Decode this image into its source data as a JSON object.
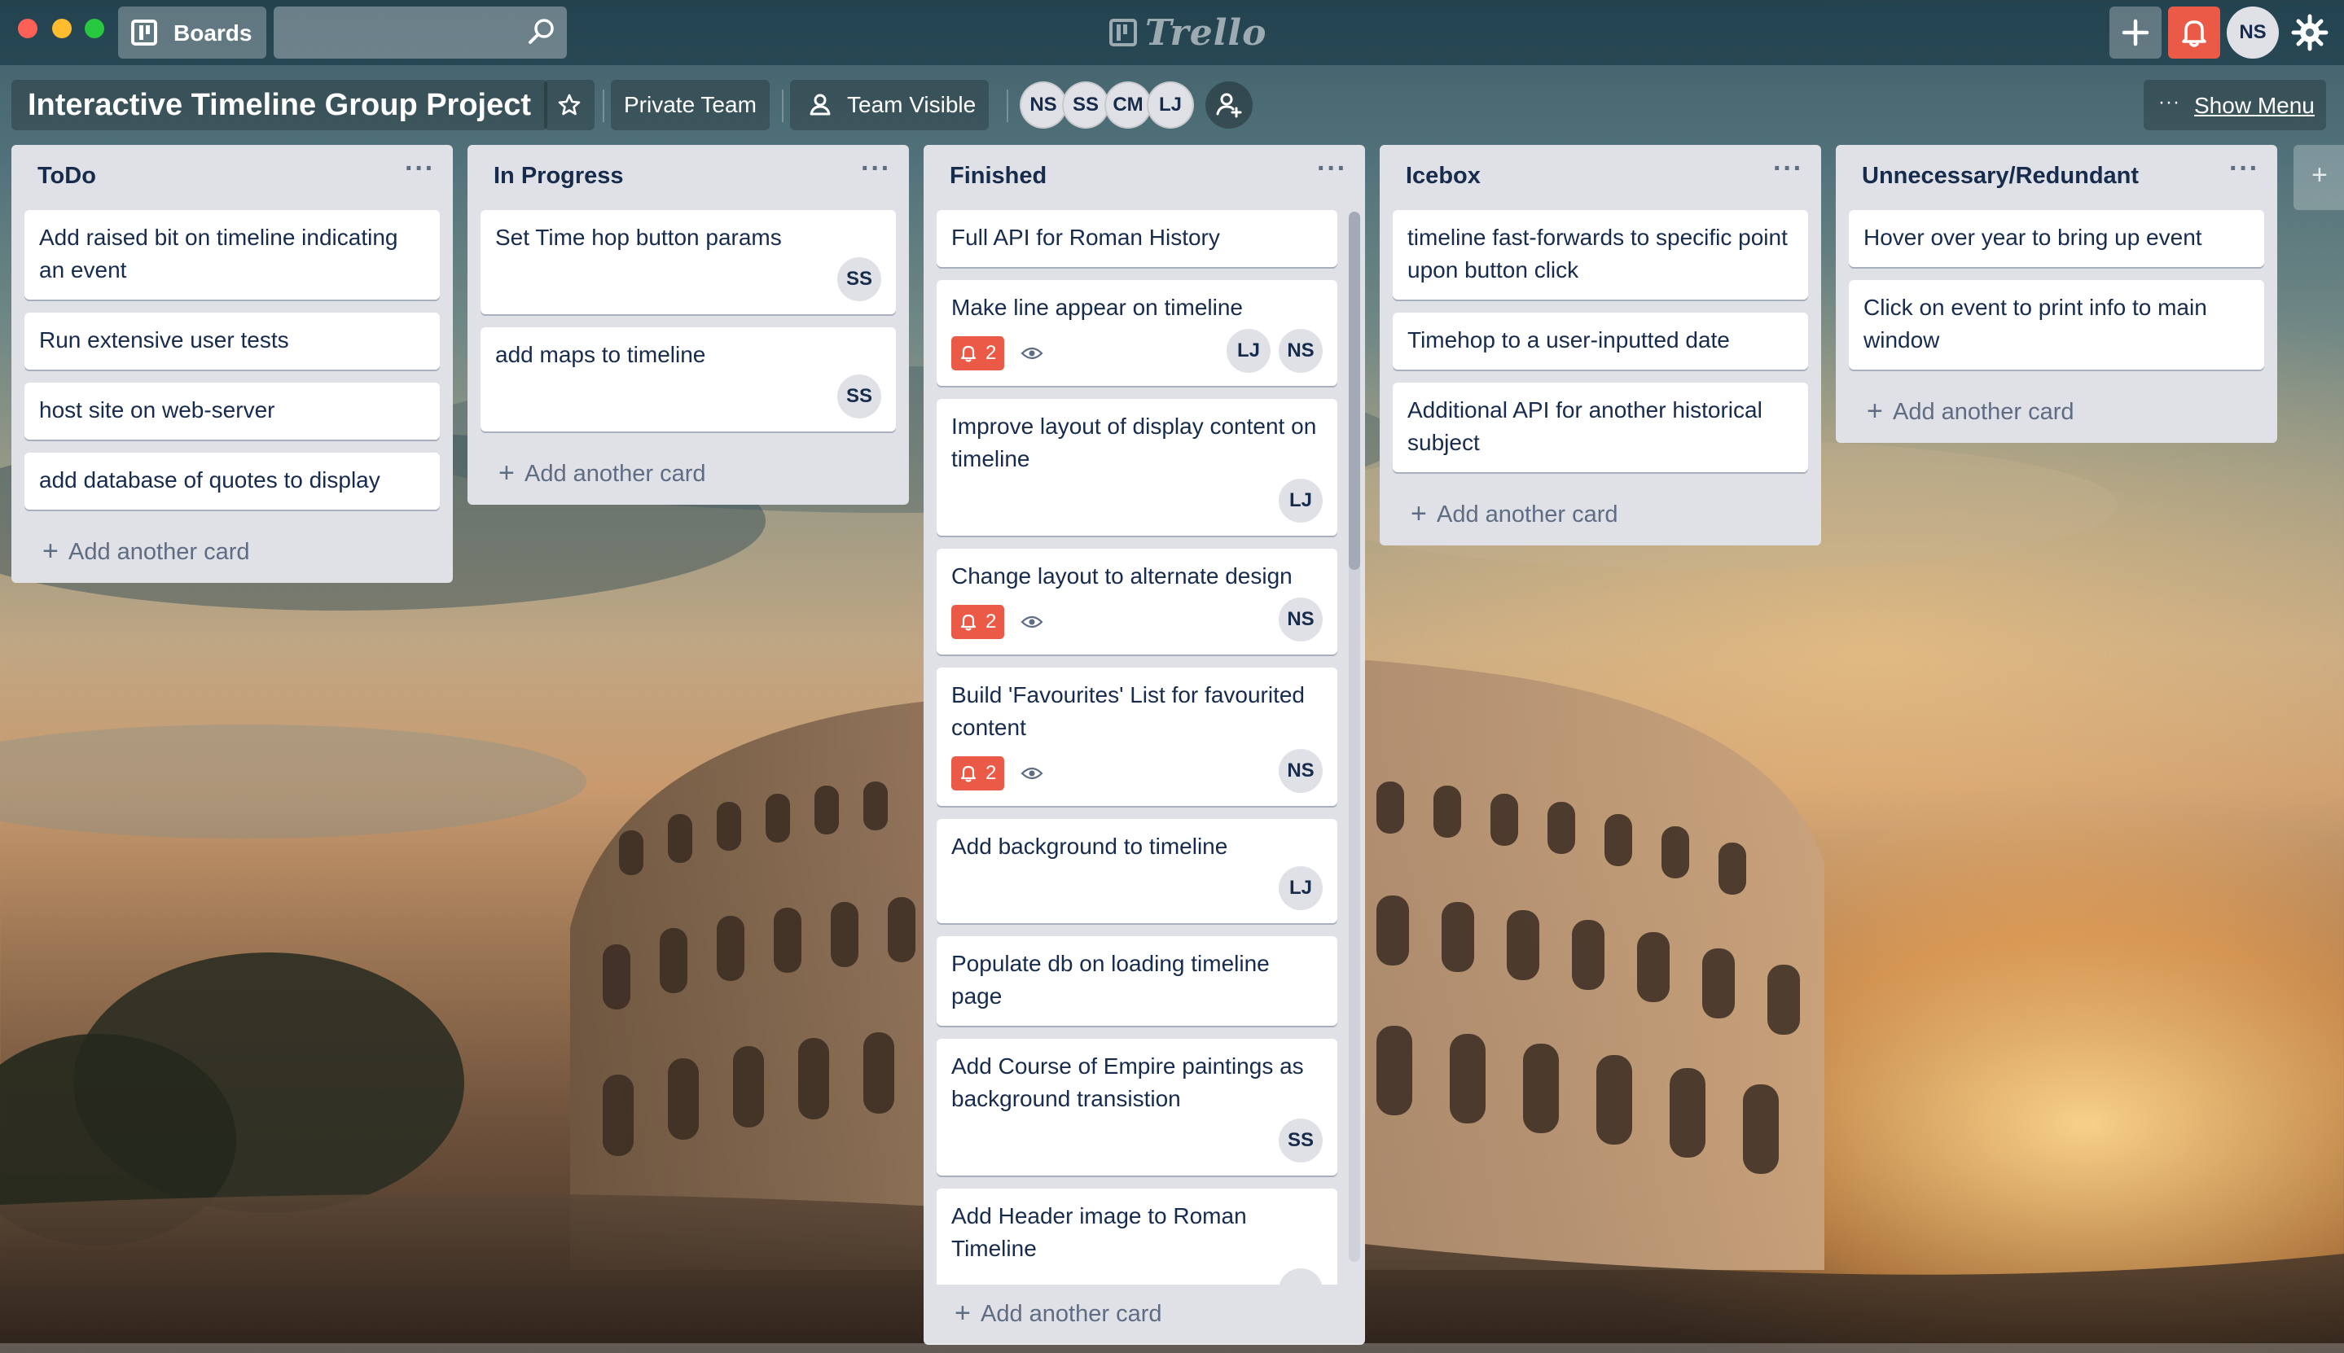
{
  "top_bar": {
    "boards_label": "Boards",
    "search_placeholder": "",
    "logo_text": "Trello",
    "user_initials": "NS",
    "notification_color": "#eb5a46"
  },
  "board": {
    "title": "Interactive Timeline Group Project",
    "team_label": "Private Team",
    "visibility_label": "Team Visible",
    "members": [
      "NS",
      "SS",
      "CM",
      "LJ"
    ],
    "show_menu_label": "Show Menu"
  },
  "lists": [
    {
      "title": "ToDo",
      "cards": [
        {
          "text": "Add raised bit on timeline indicating an event"
        },
        {
          "text": "Run extensive user tests"
        },
        {
          "text": "host site on web-server"
        },
        {
          "text": "add database of quotes to display"
        }
      ],
      "add_label": "Add another card"
    },
    {
      "title": "In Progress",
      "cards": [
        {
          "text": "Set Time hop button params",
          "members": [
            "SS"
          ]
        },
        {
          "text": "add maps to timeline",
          "members": [
            "SS"
          ]
        }
      ],
      "add_label": "Add another card"
    },
    {
      "title": "Finished",
      "cards": [
        {
          "text": "Full API for Roman History"
        },
        {
          "text": "Make line appear on timeline",
          "notifications": "2",
          "members": [
            "LJ",
            "NS"
          ]
        },
        {
          "text": "Improve layout of display content on timeline",
          "members": [
            "LJ"
          ]
        },
        {
          "text": "Change layout to alternate design",
          "notifications": "2",
          "members": [
            "NS"
          ]
        },
        {
          "text": "Build 'Favourites' List for favourited content",
          "notifications": "2",
          "members": [
            "NS"
          ]
        },
        {
          "text": "Add background to timeline",
          "members": [
            "LJ"
          ]
        },
        {
          "text": "Populate db on loading timeline page"
        },
        {
          "text": "Add Course of Empire paintings as background transistion",
          "members": [
            "SS"
          ]
        },
        {
          "text": "Add Header image to Roman Timeline"
        }
      ],
      "add_label": "Add another card"
    },
    {
      "title": "Icebox",
      "cards": [
        {
          "text": "timeline fast-forwards to specific point upon button click"
        },
        {
          "text": "Timehop to a user-inputted date"
        },
        {
          "text": "Additional API for another historical subject"
        }
      ],
      "add_label": "Add another card"
    },
    {
      "title": "Unnecessary/Redundant",
      "cards": [
        {
          "text": "Hover over year to bring up event"
        },
        {
          "text": "Click on event to print info to main window"
        }
      ],
      "add_label": "Add another card"
    }
  ]
}
